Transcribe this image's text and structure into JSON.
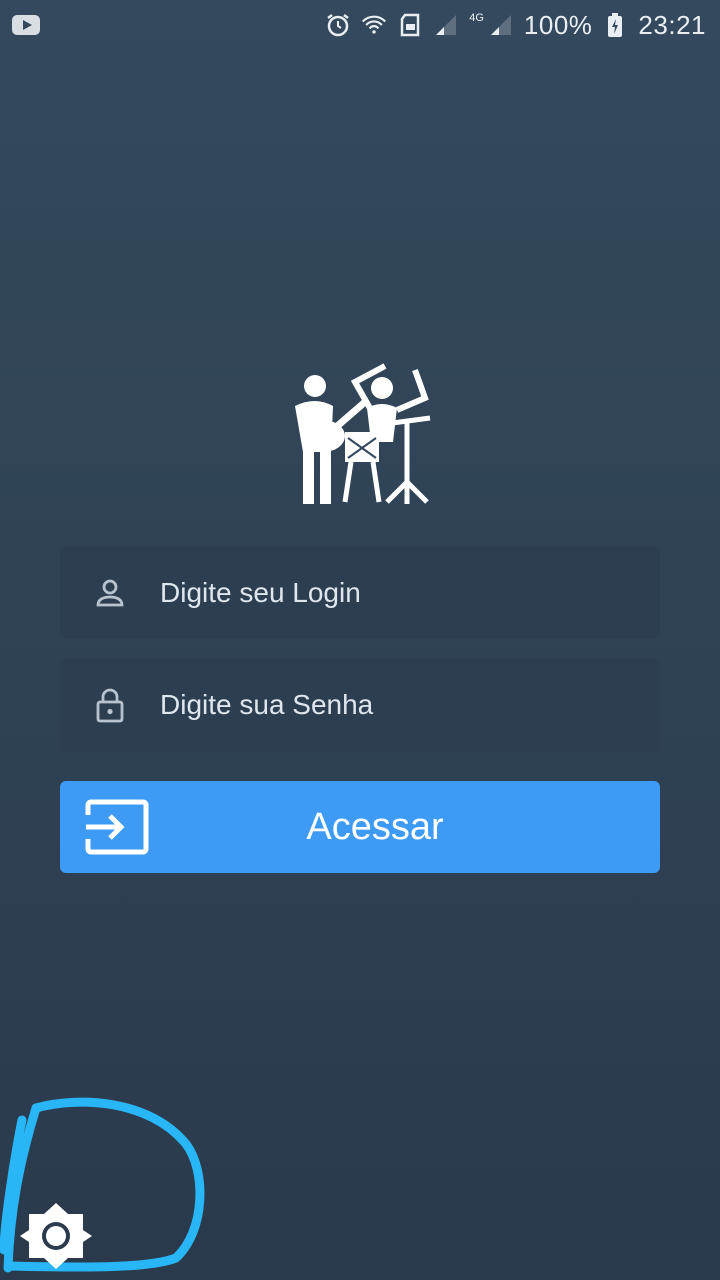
{
  "status_bar": {
    "network_type": "4G",
    "battery": "100%",
    "time": "23:21",
    "icons": [
      "youtube-icon",
      "alarm-icon",
      "wifi-icon",
      "sd-card-icon",
      "signal-icon",
      "signal-icon",
      "battery-charging-icon"
    ]
  },
  "logo": {
    "icon": "band-musicians-icon"
  },
  "login": {
    "placeholder": "Digite seu Login",
    "icon": "person-icon"
  },
  "password": {
    "placeholder": "Digite sua Senha",
    "icon": "lock-icon"
  },
  "submit": {
    "label": "Acessar",
    "icon": "login-enter-icon"
  },
  "settings": {
    "icon": "brightness-gear-icon"
  },
  "colors": {
    "background": "#34495e",
    "field_background": "#2d3e51",
    "button": "#3d9bf5",
    "annotation": "#29b6f6"
  }
}
